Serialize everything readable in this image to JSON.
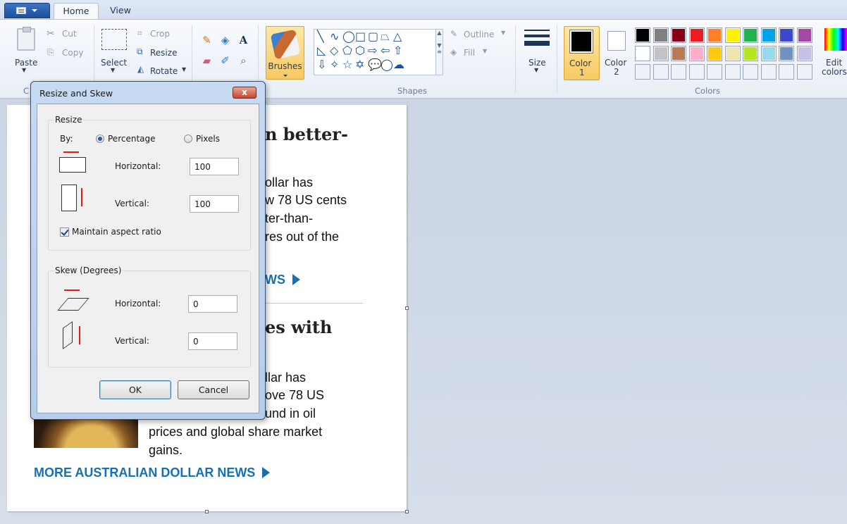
{
  "tabs": {
    "home": "Home",
    "view": "View"
  },
  "ribbon": {
    "clipboard": {
      "paste": "Paste",
      "cut": "Cut",
      "copy": "Copy",
      "group": "C"
    },
    "image": {
      "select": "Select",
      "crop": "Crop",
      "resize": "Resize",
      "rotate": "Rotate"
    },
    "tools": {
      "text_glyph": "A"
    },
    "brushes": "Brushes",
    "shapes": {
      "outline": "Outline",
      "fill": "Fill",
      "group": "Shapes"
    },
    "size": "Size",
    "color1": {
      "line1": "Color",
      "line2": "1"
    },
    "color2": {
      "line1": "Color",
      "line2": "2"
    },
    "colors_group": "Colors",
    "edit_colors": {
      "line1": "Edit",
      "line2": "colors"
    },
    "palette_row1": [
      "#000000",
      "#7f7f7f",
      "#880015",
      "#ed1c24",
      "#ff7f27",
      "#fff200",
      "#22b14c",
      "#00a2e8",
      "#3f48cc",
      "#a349a4"
    ],
    "palette_row2": [
      "#ffffff",
      "#c3c3c3",
      "#b97a57",
      "#ffaec9",
      "#ffc90e",
      "#efe4b0",
      "#b5e61d",
      "#99d9ea",
      "#7092be",
      "#c8bfe7"
    ]
  },
  "article": {
    "head1": "n better-",
    "body1": [
      "ollar has",
      "w 78 US cents",
      "ter-than-",
      "res out of the"
    ],
    "link1": "WS",
    "head2": "es with",
    "body2": [
      "llar has",
      "ove 78 US",
      "und in oil",
      "prices and global share market",
      "gains."
    ],
    "link2": "MORE AUSTRALIAN DOLLAR NEWS"
  },
  "dialog": {
    "title": "Resize and Skew",
    "close": "x",
    "resize_group": "Resize",
    "by_label": "By:",
    "percentage": "Percentage",
    "pixels": "Pixels",
    "resize_h_label": "Horizontal:",
    "resize_h_value": "100",
    "resize_v_label": "Vertical:",
    "resize_v_value": "100",
    "maintain": "Maintain aspect ratio",
    "skew_group": "Skew (Degrees)",
    "skew_h_label": "Horizontal:",
    "skew_h_value": "0",
    "skew_v_label": "Vertical:",
    "skew_v_value": "0",
    "ok": "OK",
    "cancel": "Cancel"
  }
}
